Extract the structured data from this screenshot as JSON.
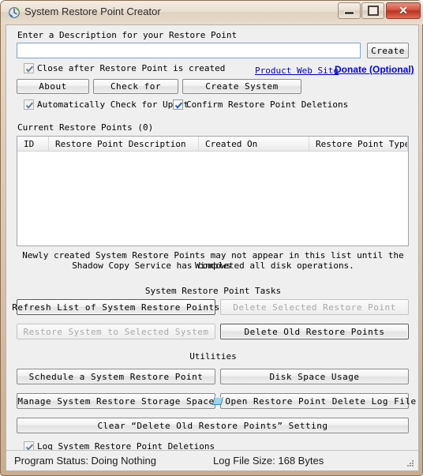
{
  "window": {
    "title": "System Restore Point Creator",
    "icon": "restore-clock-icon",
    "controls": {
      "minimize": "minimize-button",
      "maximize": "maximize-button",
      "close": "close-button",
      "close_glyph": "✕"
    }
  },
  "form": {
    "description_label": "Enter a Description for your Restore Point",
    "description_value": "",
    "description_placeholder": "",
    "create_button": "Create"
  },
  "options": {
    "close_after_create": {
      "label": "Close after Restore Point is created",
      "checked": true,
      "enabled": false
    },
    "auto_check_updates": {
      "label": "Automatically Check for Updat",
      "checked": true,
      "enabled": false
    },
    "confirm_deletions": {
      "label": "Confirm Restore Point Deletions",
      "checked": true,
      "enabled": true
    },
    "log_deletions": {
      "label": "Log System Restore Point Deletions",
      "checked": true,
      "enabled": false
    }
  },
  "links": {
    "product_site": "Product Web Site",
    "donate": "Donate (Optional)",
    "product_site_color": "#0000c8",
    "donate_color": "#0000ee"
  },
  "toolbuttons": {
    "about": "About",
    "check_for": "Check for",
    "create_system": "Create System"
  },
  "list": {
    "caption": "Current Restore Points (0)",
    "columns": [
      "ID",
      "Restore Point Description",
      "Created On",
      "Restore Point Type"
    ],
    "rows": []
  },
  "notice": {
    "line1": "Newly created System Restore Points may not appear in this list until the Windows",
    "line2": "Shadow Copy Service has completed all disk operations."
  },
  "tasks": {
    "heading": "System Restore Point Tasks",
    "refresh_list": "Refresh List of System Restore Points",
    "delete_selected": "Delete Selected Restore Point",
    "restore_system": "Restore System to Selected System",
    "delete_old": "Delete Old Restore Points"
  },
  "utilities": {
    "heading": "Utilities",
    "schedule": "Schedule a System Restore Point",
    "disk_space": "Disk Space Usage",
    "manage_storage": "Manage System Restore Storage Space",
    "open_log": "Open Restore Point Delete Log File",
    "open_log_icon": "log-file-icon",
    "clear_setting": "Clear “Delete Old Restore Points” Setting"
  },
  "statusbar": {
    "program_status": "Program Status:  Doing Nothing",
    "log_file_size": "Log File Size:  168 Bytes"
  }
}
